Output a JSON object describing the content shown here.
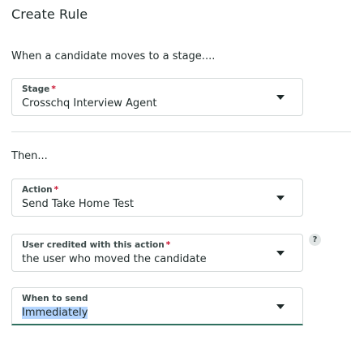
{
  "page": {
    "title": "Create Rule",
    "trigger_text": "When a candidate moves to a stage....",
    "then_text": "Then..."
  },
  "fields": {
    "stage": {
      "label": "Stage",
      "required_mark": "*",
      "value": "Crosschq Interview Agent"
    },
    "action": {
      "label": "Action",
      "required_mark": "*",
      "value": "Send Take Home Test"
    },
    "user_credited": {
      "label": "User credited with this action",
      "required_mark": "*",
      "value": "the user who moved the candidate",
      "help_symbol": "?"
    },
    "when_to_send": {
      "label": "When to send",
      "value": "Immediately"
    }
  },
  "icons": {
    "dropdown": "chevron-down-icon",
    "help": "question-icon"
  },
  "colors": {
    "focus_underline": "#2f6f5e",
    "required": "#c8102e",
    "selection_highlight": "#b4d5fe"
  }
}
